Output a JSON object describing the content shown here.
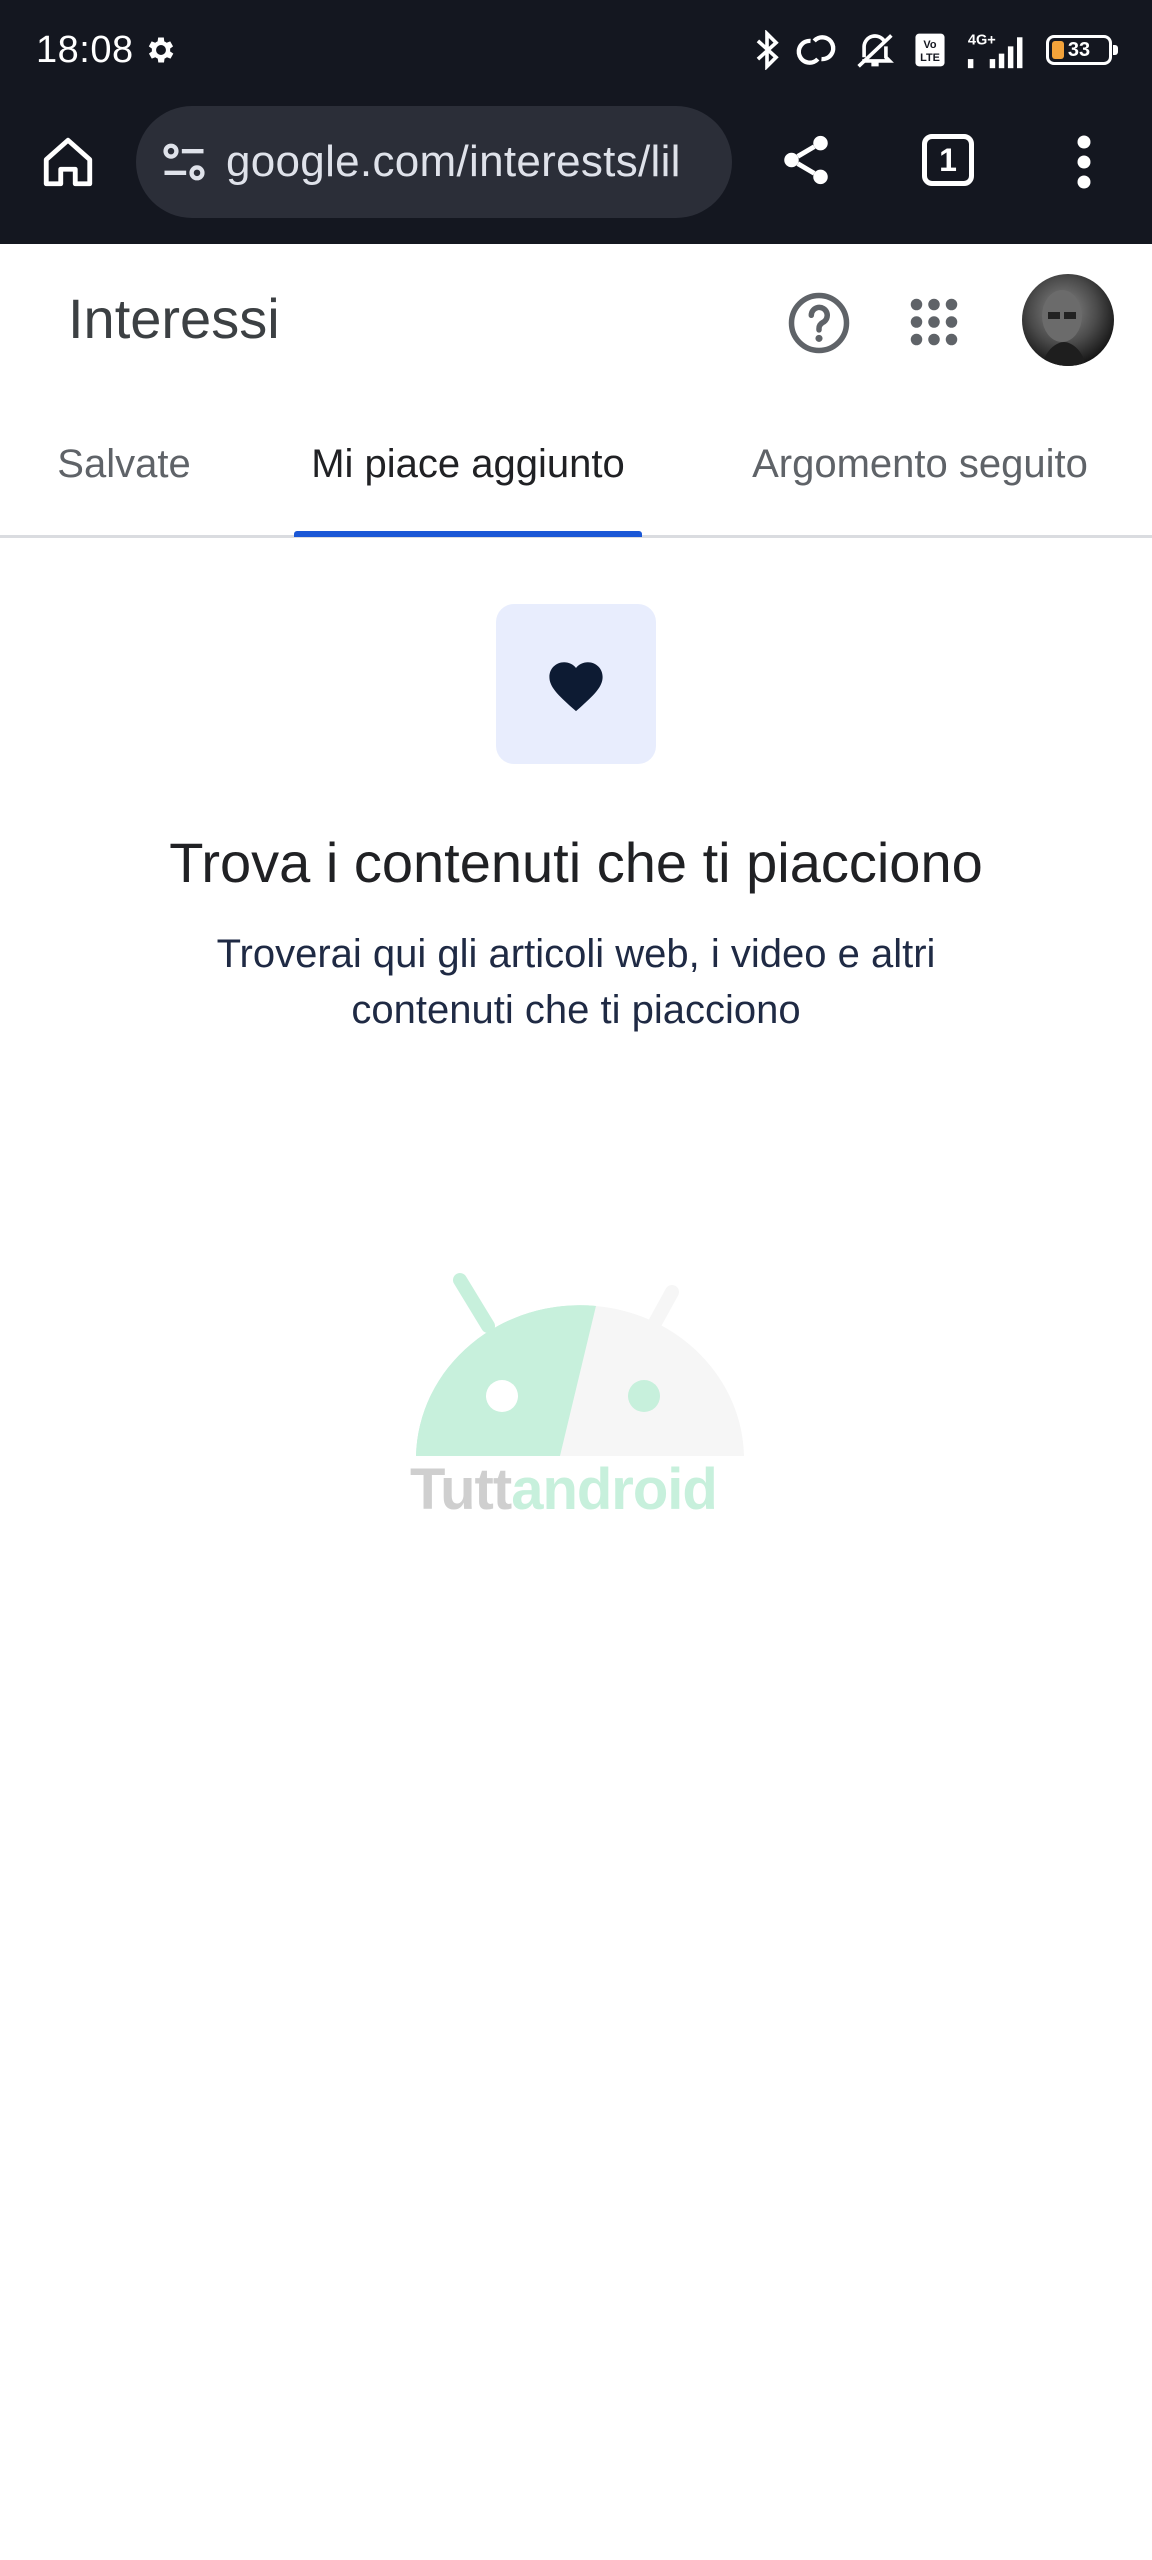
{
  "status_bar": {
    "time": "18:08",
    "battery_level": "33",
    "network_label": "4G+",
    "volte_label": "Vo LTE"
  },
  "browser": {
    "url": "google.com/interests/lil",
    "tab_count": "1"
  },
  "header": {
    "title": "Interessi"
  },
  "tabs": [
    {
      "label": "Salvate",
      "active": false
    },
    {
      "label": "Mi piace aggiunto",
      "active": true
    },
    {
      "label": "Argomento seguito",
      "active": false
    }
  ],
  "empty_state": {
    "title": "Trova i contenuti che ti piacciono",
    "description": "Troverai qui gli articoli web, i video e altri contenuti che ti piacciono",
    "icon": "heart-icon"
  },
  "watermark": {
    "part1": "Tutt",
    "part2": "android"
  },
  "colors": {
    "toolbar_bg": "#141720",
    "accent": "#1a57d6",
    "icon_box_bg": "#e8edfd",
    "heart": "#0d1b33"
  }
}
